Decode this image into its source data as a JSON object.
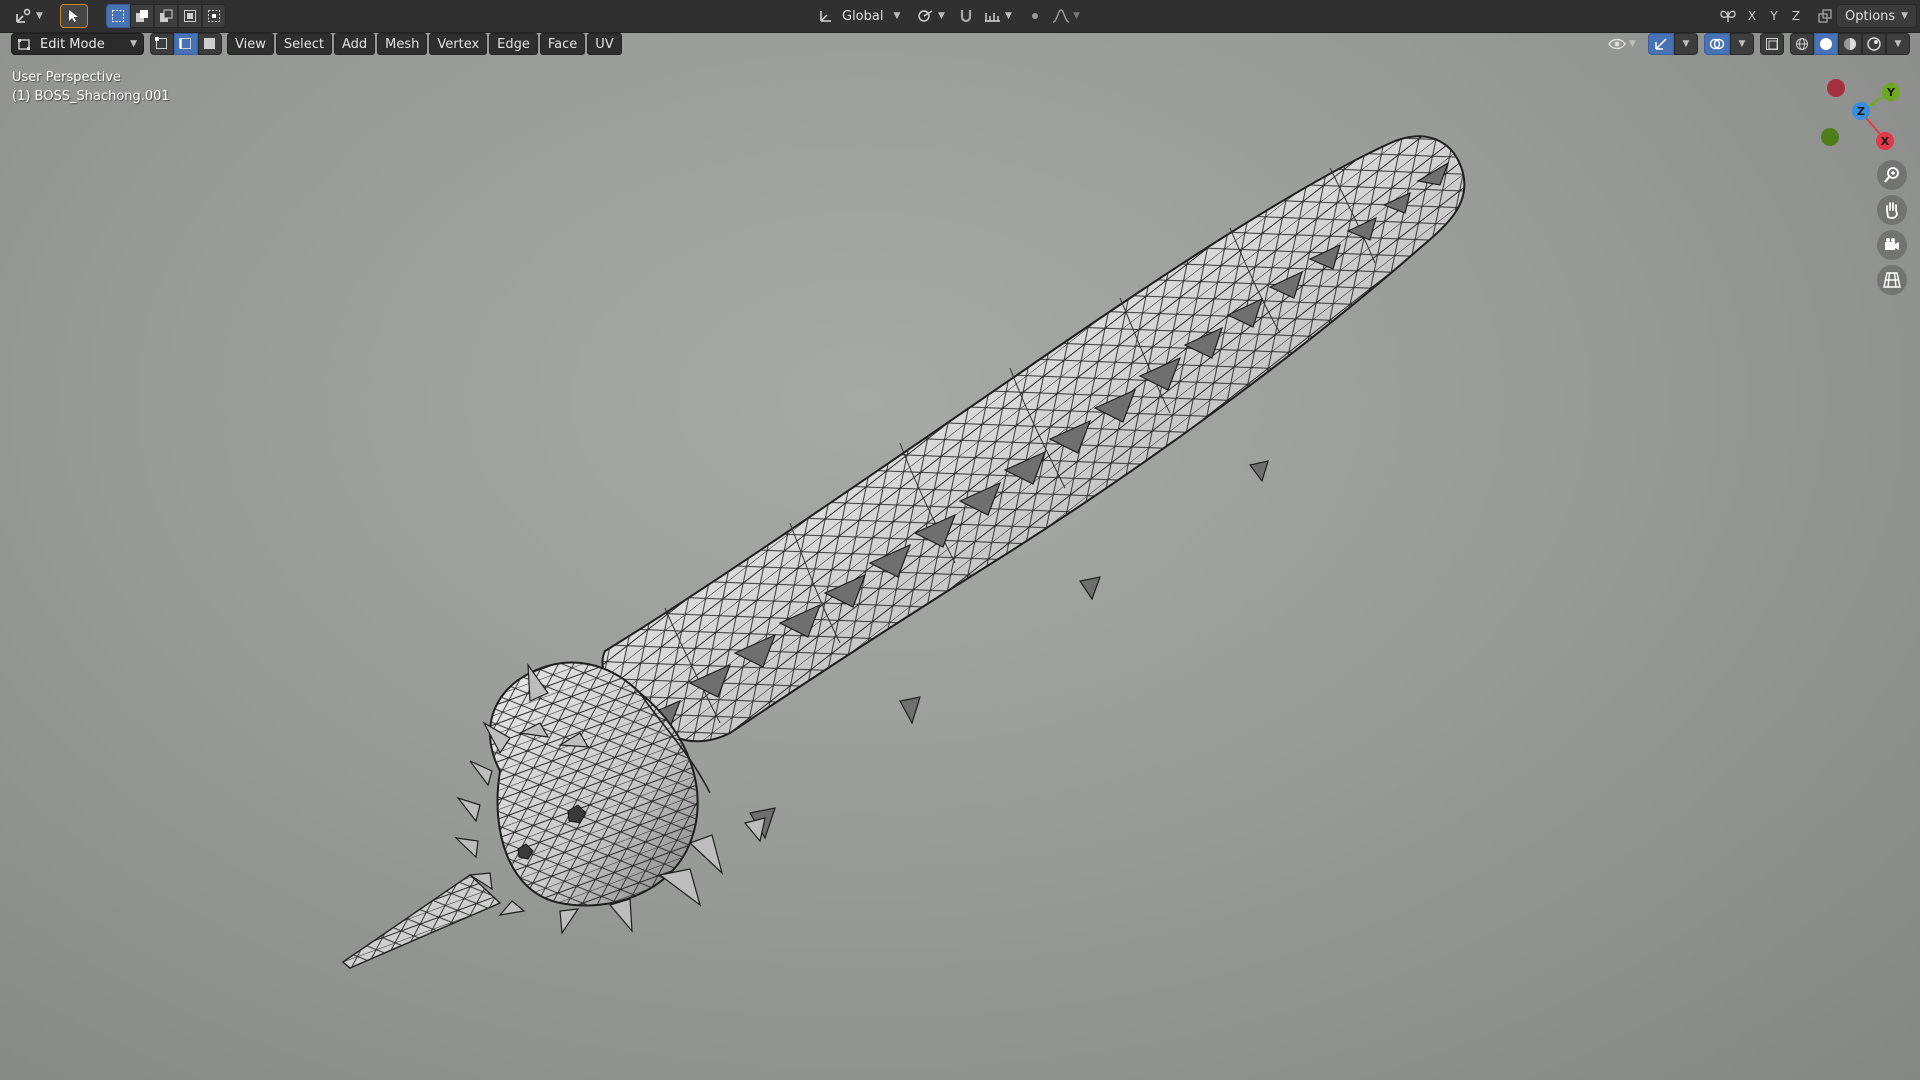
{
  "toolbar": {
    "transform_orientation": "Global",
    "mirror_axes": [
      "X",
      "Y",
      "Z"
    ],
    "options_label": "Options"
  },
  "viewport_header": {
    "mode": "Edit Mode",
    "menus": [
      "View",
      "Select",
      "Add",
      "Mesh",
      "Vertex",
      "Edge",
      "Face",
      "UV"
    ]
  },
  "overlay": {
    "view_name": "User Perspective",
    "object_name": "(1) BOSS_Shachong.001"
  },
  "gizmo": {
    "labels": {
      "x": "X",
      "y": "Y",
      "z": "Z"
    },
    "colors": {
      "x": "#e0394b",
      "y": "#6ea91f",
      "z": "#3a8de0",
      "neg_x": "#a3303e",
      "neg_y": "#4f7d1a"
    }
  },
  "icons": {
    "editor_type": "object-gizmo-icon",
    "select_tool": "cursor-select-icon",
    "selection_modes": [
      "select-new-icon",
      "select-extend-icon",
      "select-subtract-icon",
      "select-invert-icon",
      "select-intersect-icon"
    ],
    "mesh_select": [
      "vertex-select-icon",
      "edge-select-icon",
      "face-select-icon"
    ],
    "nav": [
      "zoom-icon",
      "pan-hand-icon",
      "camera-icon",
      "grid-ortho-icon"
    ],
    "shading": [
      "wireframe-icon",
      "solid-icon",
      "material-icon",
      "rendered-icon"
    ]
  }
}
